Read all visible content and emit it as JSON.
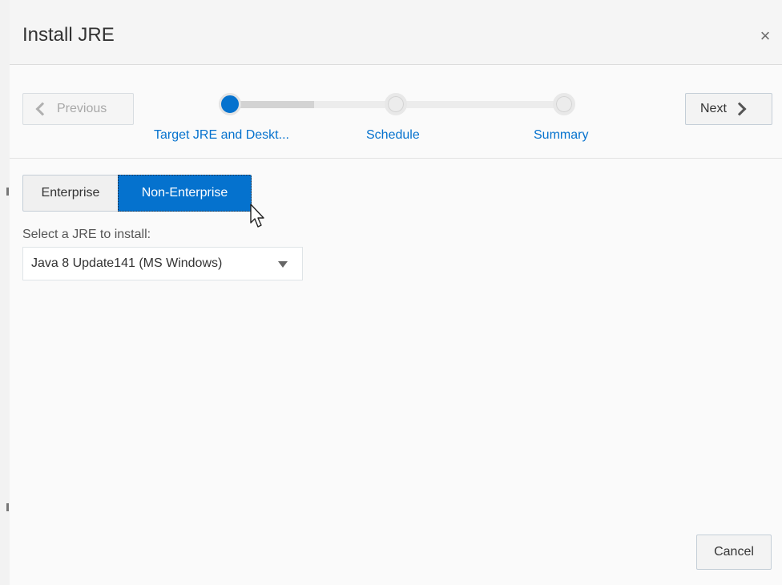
{
  "dialog": {
    "title": "Install JRE",
    "close_glyph": "×"
  },
  "train": {
    "previous_label": "Previous",
    "next_label": "Next",
    "stops": [
      {
        "label": "Target JRE and Deskt...",
        "state": "active"
      },
      {
        "label": "Schedule",
        "state": "idle"
      },
      {
        "label": "Summary",
        "state": "idle"
      }
    ]
  },
  "content": {
    "segments": {
      "enterprise": "Enterprise",
      "non_enterprise": "Non-Enterprise",
      "selected": "Non-Enterprise"
    },
    "jre_label": "Select a JRE to install:",
    "jre_select_value": "Java 8 Update141 (MS Windows)"
  },
  "footer": {
    "cancel_label": "Cancel"
  },
  "colors": {
    "accent": "#0572ce",
    "link": "#0572ce",
    "disabled_text": "#a8a8a8"
  },
  "icons": [
    "close-icon",
    "chevron-left-icon",
    "chevron-right-icon",
    "dropdown-caret-icon",
    "mouse-pointer-icon"
  ]
}
